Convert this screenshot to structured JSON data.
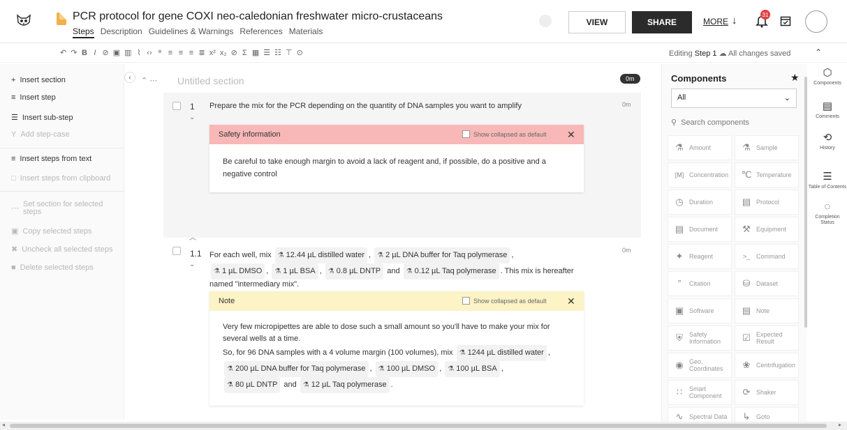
{
  "header": {
    "title": "PCR protocol for gene COXI neo-caledonian freshwater micro-crustaceans",
    "tabs": [
      "Steps",
      "Description",
      "Guidelines & Warnings",
      "References",
      "Materials"
    ],
    "view_label": "VIEW",
    "share_label": "SHARE",
    "more_label": "MORE",
    "notification_count": "31"
  },
  "toolbar": {
    "editing_label": "Editing",
    "step_label": "Step 1",
    "saved_label": "All changes saved"
  },
  "left_panel": {
    "items": [
      {
        "label": "Insert section",
        "icon": "+"
      },
      {
        "label": "Insert step",
        "icon": "≡"
      },
      {
        "label": "Insert sub-step",
        "icon": "☰"
      },
      {
        "label": "Add step-case",
        "icon": "Y"
      },
      {
        "label": "Insert steps from text",
        "icon": "≡"
      },
      {
        "label": "Insert steps from clipboard",
        "icon": "□"
      },
      {
        "label": "Set section for selected steps",
        "icon": "⋯"
      },
      {
        "label": "Copy selected steps",
        "icon": "▣"
      },
      {
        "label": "Uncheck all selected steps",
        "icon": "✖"
      },
      {
        "label": "Delete selected steps",
        "icon": "■"
      }
    ]
  },
  "section": {
    "title": "Untitled section",
    "time": "0m"
  },
  "step1": {
    "number": "1",
    "text": "Prepare the mix for the PCR depending on the quantity of DNA samples you want to amplify",
    "time": "0m",
    "callout_title": "Safety information",
    "collapsed_label": "Show collapsed as default",
    "body": "Be careful to take enough margin to avoid a lack of reagent and, if possible, do a positive and a negative control"
  },
  "step11": {
    "number": "1.1",
    "time": "0m",
    "t_prefix": "For each well, mix",
    "r1": "12.44 µL distilled water",
    "r2": "2 µL DNA buffer for Taq polymerase",
    "r3": "1 µL DMSO",
    "r4": "1 µL BSA",
    "r5": "0.8 µL DNTP",
    "and": "and",
    "r6": "0.12 µL Taq polymerase",
    "t_suffix": ". This mix is hereafter",
    "t_line3": "named \"intermediary mix\".",
    "comma": ",",
    "note_title": "Note",
    "collapsed_label": "Show collapsed as default",
    "note_line1": "Very few micropipettes are able to dose such a small amount so you'll have to make your mix for",
    "note_line2": "several wells at a time.",
    "note_prefix": "So, for 96 DNA samples with a 4 volume margin (100 volumes), mix",
    "n1": "1244 µL distilled water",
    "n2": "200 µL DNA buffer for Taq polymerase",
    "n3": "100 µL DMSO",
    "n4": "100 µL BSA",
    "n5": "80 µL DNTP",
    "n6": "12 µL Taq polymerase",
    "period": "."
  },
  "components": {
    "title": "Components",
    "filter": "All",
    "search_placeholder": "Search components",
    "items": [
      {
        "label": "Amount",
        "icon": "⚗"
      },
      {
        "label": "Sample",
        "icon": "⚗"
      },
      {
        "label": "Concentration",
        "icon": "[M]"
      },
      {
        "label": "Temperature",
        "icon": "℃"
      },
      {
        "label": "Duration",
        "icon": "◷"
      },
      {
        "label": "Protocol",
        "icon": "▤"
      },
      {
        "label": "Document",
        "icon": "▤"
      },
      {
        "label": "Equipment",
        "icon": "⚒"
      },
      {
        "label": "Reagent",
        "icon": "✦"
      },
      {
        "label": "Command",
        "icon": ">_"
      },
      {
        "label": "Citation",
        "icon": "”"
      },
      {
        "label": "Dataset",
        "icon": "⛁"
      },
      {
        "label": "Software",
        "icon": "▣"
      },
      {
        "label": "Note",
        "icon": "▤"
      },
      {
        "label": "Safety Information",
        "icon": "⛨"
      },
      {
        "label": "Expected Result",
        "icon": "☑"
      },
      {
        "label": "Geo. Coordinates",
        "icon": "◉"
      },
      {
        "label": "Centrifugation",
        "icon": "❀"
      },
      {
        "label": "Smart Component",
        "icon": "∷"
      },
      {
        "label": "Shaker",
        "icon": "⟳"
      },
      {
        "label": "Spectral Data",
        "icon": "∿"
      },
      {
        "label": "Goto",
        "icon": "↳"
      }
    ]
  },
  "right_rail": {
    "items": [
      {
        "label": "Components",
        "icon": "⬡"
      },
      {
        "label": "Comments",
        "icon": "▤"
      },
      {
        "label": "History",
        "icon": "⟲"
      },
      {
        "label": "Table of Contents",
        "icon": "☰"
      },
      {
        "label": "Completion Status",
        "icon": "◌"
      }
    ]
  }
}
